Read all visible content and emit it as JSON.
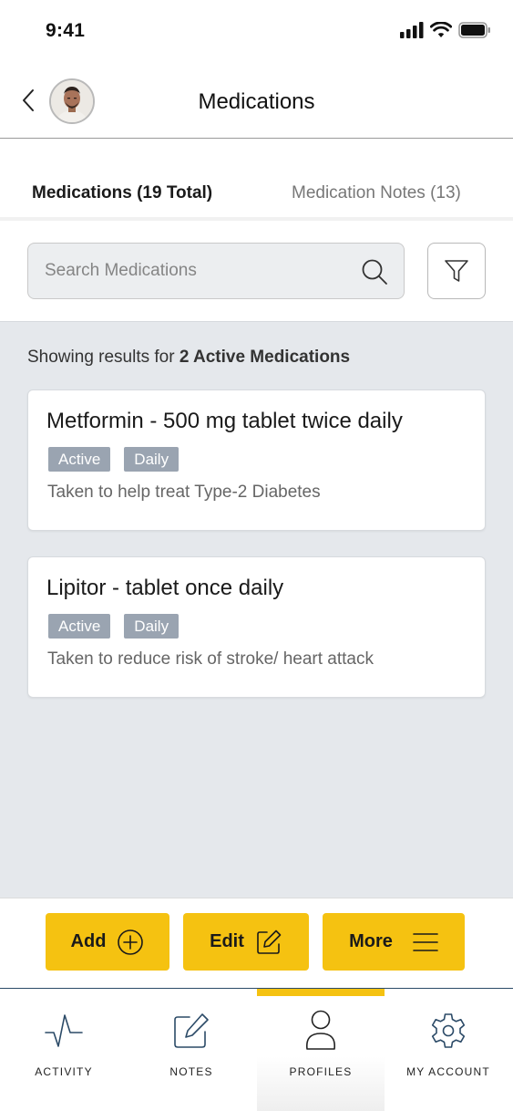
{
  "status_bar": {
    "time": "9:41",
    "icons": [
      "signal-icon",
      "wifi-icon",
      "battery-icon"
    ]
  },
  "header": {
    "title": "Medications",
    "back_icon": "chevron-left-icon",
    "avatar": "user-avatar"
  },
  "tabs": [
    {
      "label": "Medications (19 Total)",
      "active": true
    },
    {
      "label": "Medication Notes (13)",
      "active": false
    }
  ],
  "search": {
    "placeholder": "Search Medications",
    "value": "",
    "icon": "search-icon",
    "filter_icon": "filter-icon"
  },
  "results": {
    "prefix": "Showing results for",
    "bold": "2 Active Medications"
  },
  "medications": [
    {
      "title": "Metformin - 500 mg tablet twice daily",
      "tags": [
        "Active",
        "Daily"
      ],
      "description": "Taken to help treat Type-2 Diabetes"
    },
    {
      "title": "Lipitor - tablet once daily",
      "tags": [
        "Active",
        "Daily"
      ],
      "description": "Taken to reduce risk of stroke/ heart attack"
    }
  ],
  "actions": {
    "add": "Add",
    "edit": "Edit",
    "more": "More"
  },
  "bottom_nav": [
    {
      "label": "ACTIVITY",
      "icon": "activity-icon",
      "active": false
    },
    {
      "label": "NOTES",
      "icon": "notes-icon",
      "active": false
    },
    {
      "label": "PROFILES",
      "icon": "profile-icon",
      "active": true
    },
    {
      "label": "MY ACCOUNT",
      "icon": "gear-icon",
      "active": false
    }
  ],
  "colors": {
    "accent": "#f5c211",
    "tag_bg": "#9aa4b1",
    "content_bg": "#e5e8ec",
    "nav_border": "#2b4a67"
  }
}
